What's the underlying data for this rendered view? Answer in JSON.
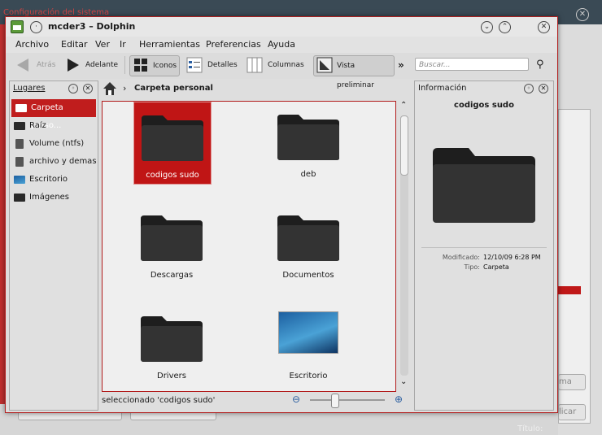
{
  "background_window": {
    "title": "Configuración del sistema",
    "right_button_1": "ma",
    "right_button_2": "licar",
    "bottom_label": "Título:"
  },
  "window": {
    "title": "mcder3 – Dolphin"
  },
  "menubar": [
    "Archivo",
    "Editar",
    "Ver",
    "Ir",
    "Herramientas",
    "Preferencias",
    "Ayuda"
  ],
  "toolbar": {
    "back": "Atrás",
    "forward": "Adelante",
    "icons": "Iconos",
    "details": "Detalles",
    "columns": "Columnas",
    "preview": "Vista preliminar",
    "overflow": "»",
    "search_placeholder": "Buscar..."
  },
  "places": {
    "title": "Lugares",
    "items": [
      {
        "label": "Carpeta perso...",
        "selected": true
      },
      {
        "label": "Raíz"
      },
      {
        "label": "Volume (ntfs)"
      },
      {
        "label": "archivo y demas"
      },
      {
        "label": "Escritorio"
      },
      {
        "label": "Imágenes"
      }
    ]
  },
  "breadcrumb": {
    "location": "Carpeta personal"
  },
  "files": [
    {
      "name": "codigos sudo",
      "type": "folder",
      "selected": true
    },
    {
      "name": "deb",
      "type": "folder"
    },
    {
      "name": "Descargas",
      "type": "folder"
    },
    {
      "name": "Documentos",
      "type": "folder"
    },
    {
      "name": "Drivers",
      "type": "folder"
    },
    {
      "name": "Escritorio",
      "type": "desktop"
    }
  ],
  "status": {
    "text": "seleccionado 'codigos sudo'",
    "zoom_level": 0.3
  },
  "info": {
    "title": "Información",
    "name": "codigos sudo",
    "modified_label": "Modificado:",
    "modified_value": "12/10/09 6:28 PM",
    "type_label": "Tipo:",
    "type_value": "Carpeta"
  },
  "colors": {
    "accent": "#c01d1d"
  }
}
